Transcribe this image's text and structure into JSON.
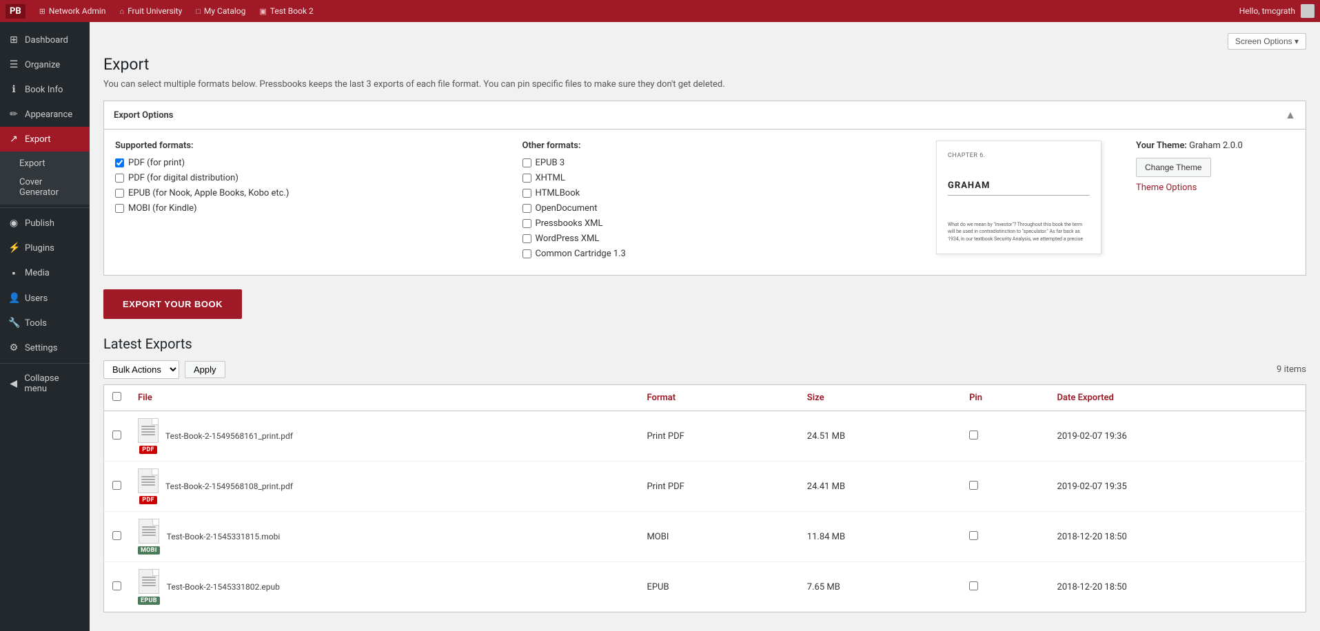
{
  "topbar": {
    "logo": "PB",
    "nav_items": [
      {
        "icon": "⊞",
        "label": "Network Admin"
      },
      {
        "icon": "⌂",
        "label": "Fruit University"
      },
      {
        "icon": "□",
        "label": "My Catalog"
      },
      {
        "icon": "▣",
        "label": "Test Book 2"
      }
    ],
    "hello_text": "Hello, tmcgrath",
    "screen_options_label": "Screen Options"
  },
  "sidebar": {
    "items": [
      {
        "id": "dashboard",
        "icon": "⊞",
        "label": "Dashboard"
      },
      {
        "id": "organize",
        "icon": "☰",
        "label": "Organize"
      },
      {
        "id": "book-info",
        "icon": "ℹ",
        "label": "Book Info"
      },
      {
        "id": "appearance",
        "icon": "✏",
        "label": "Appearance"
      },
      {
        "id": "export",
        "icon": "↗",
        "label": "Export",
        "active": true
      }
    ],
    "submenu": [
      {
        "id": "export-sub",
        "label": "Export"
      },
      {
        "id": "cover-generator",
        "label": "Cover Generator"
      }
    ],
    "bottom_items": [
      {
        "id": "publish",
        "icon": "◉",
        "label": "Publish"
      },
      {
        "id": "plugins",
        "icon": "🔌",
        "label": "Plugins"
      },
      {
        "id": "media",
        "icon": "⬛",
        "label": "Media"
      },
      {
        "id": "users",
        "icon": "👤",
        "label": "Users"
      },
      {
        "id": "tools",
        "icon": "🔧",
        "label": "Tools"
      },
      {
        "id": "settings",
        "icon": "⚙",
        "label": "Settings"
      }
    ],
    "collapse_label": "Collapse menu"
  },
  "page": {
    "title": "Export",
    "description": "You can select multiple formats below. Pressbooks keeps the last 3 exports of each file format. You can pin specific files to make sure they don't get deleted."
  },
  "export_options": {
    "header_label": "Export Options",
    "supported_formats_label": "Supported formats:",
    "other_formats_label": "Other formats:",
    "supported_formats": [
      {
        "id": "pdf-print",
        "label": "PDF (for print)",
        "checked": true
      },
      {
        "id": "pdf-digital",
        "label": "PDF (for digital distribution)",
        "checked": false
      },
      {
        "id": "epub-nook",
        "label": "EPUB (for Nook, Apple Books, Kobo etc.)",
        "checked": false
      },
      {
        "id": "mobi-kindle",
        "label": "MOBI (for Kindle)",
        "checked": false
      }
    ],
    "other_formats": [
      {
        "id": "epub3",
        "label": "EPUB 3",
        "checked": false
      },
      {
        "id": "xhtml",
        "label": "XHTML",
        "checked": false
      },
      {
        "id": "htmlbook",
        "label": "HTMLBook",
        "checked": false
      },
      {
        "id": "opendocument",
        "label": "OpenDocument",
        "checked": false
      },
      {
        "id": "pressbooks-xml",
        "label": "Pressbooks XML",
        "checked": false
      },
      {
        "id": "wordpress-xml",
        "label": "WordPress XML",
        "checked": false
      },
      {
        "id": "common-cartridge",
        "label": "Common Cartridge 1.3",
        "checked": false
      }
    ],
    "book_preview": {
      "chapter": "CHAPTER 6.",
      "title": "GRAHAM",
      "text": "What do we mean by \"investor\"? Throughout this book the term will be used in contradistinction to \"speculator.\" As far back as 1934, in our textbook Security Analysis, we attempted a precise"
    },
    "theme": {
      "label": "Your Theme:",
      "name": "Graham 2.0.0",
      "change_btn": "Change Theme",
      "options_link": "Theme Options"
    }
  },
  "export_button_label": "EXPORT YOUR BOOK",
  "latest_exports": {
    "title": "Latest Exports",
    "bulk_actions_label": "Bulk Actions",
    "apply_label": "Apply",
    "items_count": "9 items",
    "columns": [
      {
        "id": "file",
        "label": "File"
      },
      {
        "id": "format",
        "label": "Format"
      },
      {
        "id": "size",
        "label": "Size"
      },
      {
        "id": "pin",
        "label": "Pin"
      },
      {
        "id": "date-exported",
        "label": "Date Exported"
      }
    ],
    "rows": [
      {
        "id": 1,
        "filename": "Test-Book-2-1549568161_print.pdf",
        "format": "Print PDF",
        "size": "24.51 MB",
        "pin": false,
        "date": "2019-02-07 19:36",
        "badge": "PDF",
        "badge_class": "badge-pdf"
      },
      {
        "id": 2,
        "filename": "Test-Book-2-1549568108_print.pdf",
        "format": "Print PDF",
        "size": "24.41 MB",
        "pin": false,
        "date": "2019-02-07 19:35",
        "badge": "PDF",
        "badge_class": "badge-pdf"
      },
      {
        "id": 3,
        "filename": "Test-Book-2-1545331815.mobi",
        "format": "MOBI",
        "size": "11.84 MB",
        "pin": false,
        "date": "2018-12-20 18:50",
        "badge": "MOBI",
        "badge_class": "badge-mobi"
      },
      {
        "id": 4,
        "filename": "Test-Book-2-1545331802.epub",
        "format": "EPUB",
        "size": "7.65 MB",
        "pin": false,
        "date": "2018-12-20 18:50",
        "badge": "EPUB",
        "badge_class": "badge-epub"
      }
    ]
  },
  "colors": {
    "brand_red": "#a01926",
    "sidebar_bg": "#23282d"
  }
}
